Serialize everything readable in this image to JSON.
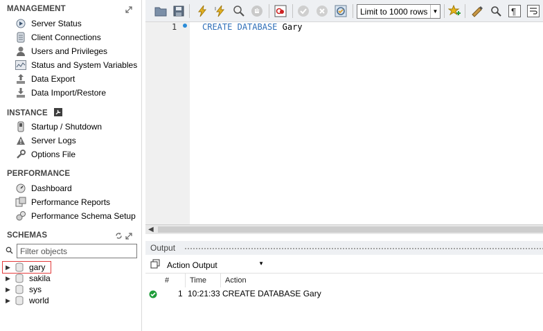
{
  "sidebar": {
    "management": {
      "header": "MANAGEMENT",
      "items": [
        {
          "label": "Server Status",
          "icon": "server-status-icon"
        },
        {
          "label": "Client Connections",
          "icon": "client-connections-icon"
        },
        {
          "label": "Users and Privileges",
          "icon": "users-icon"
        },
        {
          "label": "Status and System Variables",
          "icon": "variables-icon"
        },
        {
          "label": "Data Export",
          "icon": "data-export-icon"
        },
        {
          "label": "Data Import/Restore",
          "icon": "data-import-icon"
        }
      ]
    },
    "instance": {
      "header": "INSTANCE",
      "items": [
        {
          "label": "Startup / Shutdown",
          "icon": "startup-icon"
        },
        {
          "label": "Server Logs",
          "icon": "warning-icon"
        },
        {
          "label": "Options File",
          "icon": "wrench-icon"
        }
      ]
    },
    "performance": {
      "header": "PERFORMANCE",
      "items": [
        {
          "label": "Dashboard",
          "icon": "dashboard-icon"
        },
        {
          "label": "Performance Reports",
          "icon": "reports-icon"
        },
        {
          "label": "Performance Schema Setup",
          "icon": "schema-setup-icon"
        }
      ]
    },
    "schemas": {
      "header": "SCHEMAS",
      "filter_placeholder": "Filter objects",
      "items": [
        {
          "name": "gary"
        },
        {
          "name": "sakila"
        },
        {
          "name": "sys"
        },
        {
          "name": "world"
        }
      ]
    }
  },
  "toolbar": {
    "limit_label": "Limit to 1000 rows"
  },
  "editor": {
    "line_number": "1",
    "code_keyword1": "CREATE",
    "code_keyword2": "DATABASE",
    "code_identifier": "Gary"
  },
  "output": {
    "header": "Output",
    "selector": "Action Output",
    "columns": [
      "#",
      "Time",
      "Action"
    ],
    "rows": [
      {
        "num": "1",
        "time": "10:21:33",
        "action": "CREATE DATABASE Gary",
        "status": "success"
      }
    ]
  },
  "colors": {
    "keyword": "#2f6fb8",
    "highlight_border": "#e23a3a",
    "success": "#1f9d3a"
  }
}
